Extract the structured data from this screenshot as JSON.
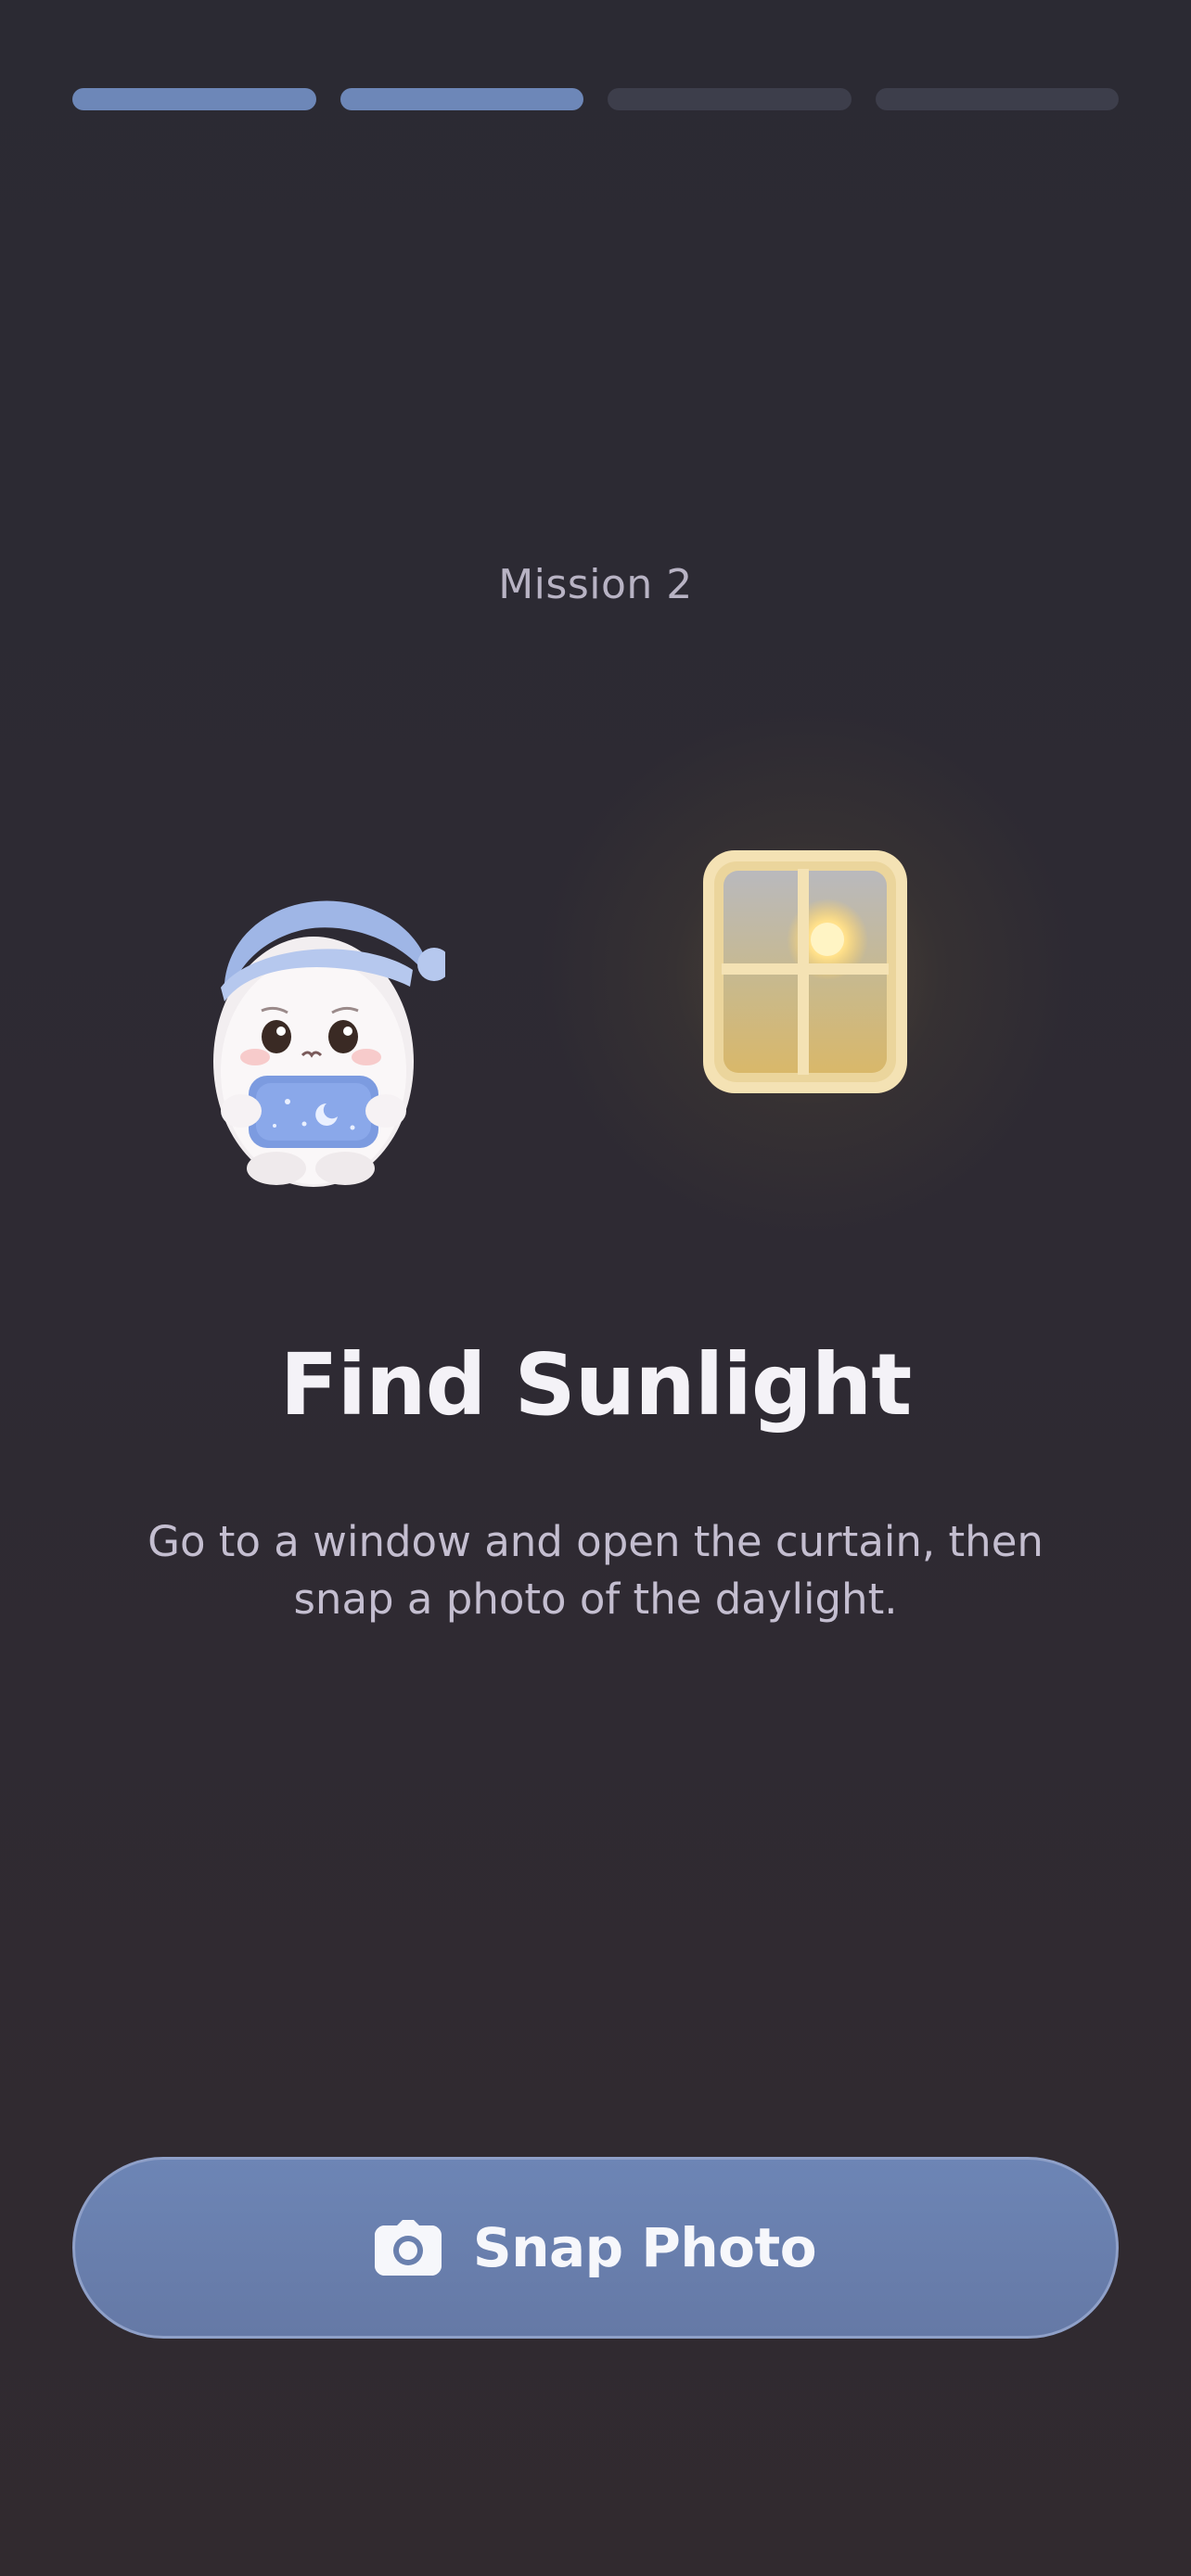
{
  "progress": {
    "total_steps": 4,
    "completed_steps": 2,
    "active_color": "#6d87b8",
    "inactive_color": "#3d3e4b"
  },
  "mission": {
    "label": "Mission 2"
  },
  "illustration": {
    "character_icon": "sleepy-mascot-with-pillow",
    "window_icon": "sunlit-window"
  },
  "content": {
    "title": "Find Sunlight",
    "description": "Go to a window and open the curtain, then snap a photo of the daylight."
  },
  "action_button": {
    "label": "Snap Photo",
    "icon": "camera-icon",
    "color": "#6d85b5"
  }
}
